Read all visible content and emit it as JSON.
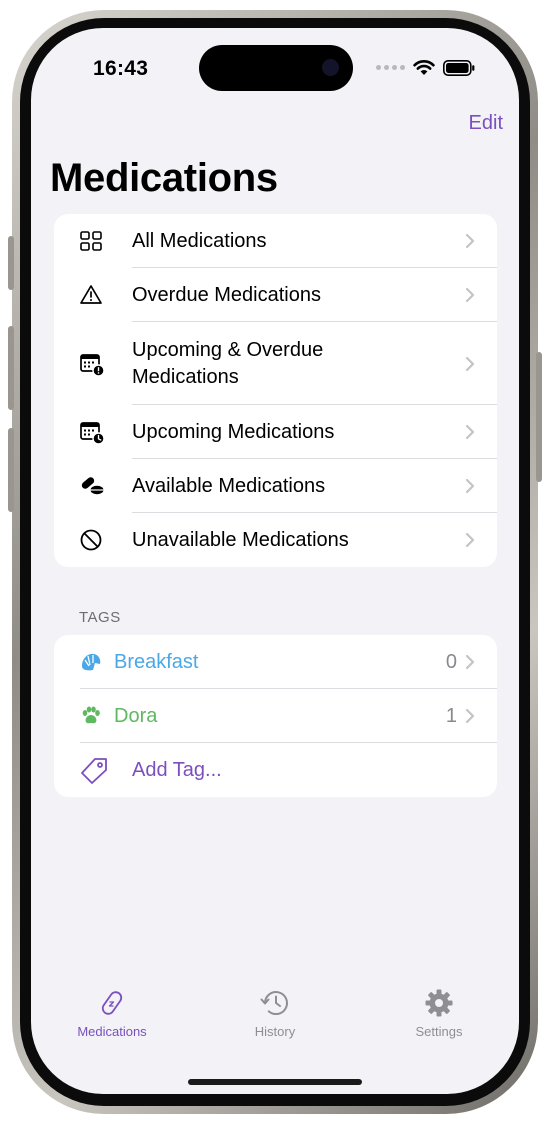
{
  "status_bar": {
    "time": "16:43"
  },
  "nav": {
    "edit_label": "Edit",
    "title": "Medications"
  },
  "lists": [
    {
      "label": "All Medications",
      "icon": "grid-icon"
    },
    {
      "label": "Overdue Medications",
      "icon": "warning-triangle-icon"
    },
    {
      "label": "Upcoming & Overdue Medications",
      "icon": "calendar-alert-icon"
    },
    {
      "label": "Upcoming Medications",
      "icon": "calendar-clock-icon"
    },
    {
      "label": "Available Medications",
      "icon": "pills-icon"
    },
    {
      "label": "Unavailable Medications",
      "icon": "prohibited-icon"
    }
  ],
  "tags_section": {
    "header": "TAGS",
    "tags": [
      {
        "label": "Breakfast",
        "count": "0",
        "color": "#4aa8e8",
        "icon": "croissant-icon"
      },
      {
        "label": "Dora",
        "count": "1",
        "color": "#5fb960",
        "icon": "pawprint-icon"
      }
    ],
    "add_label": "Add Tag...",
    "add_color": "#7b4fbf"
  },
  "tab_bar": {
    "tabs": [
      {
        "label": "Medications",
        "icon": "pill-icon",
        "active": true
      },
      {
        "label": "History",
        "icon": "history-clock-icon",
        "active": false
      },
      {
        "label": "Settings",
        "icon": "gear-icon",
        "active": false
      }
    ]
  },
  "colors": {
    "accent": "#7b4fbf",
    "background": "#f2f2f7",
    "chevron": "#c4c4c7"
  }
}
